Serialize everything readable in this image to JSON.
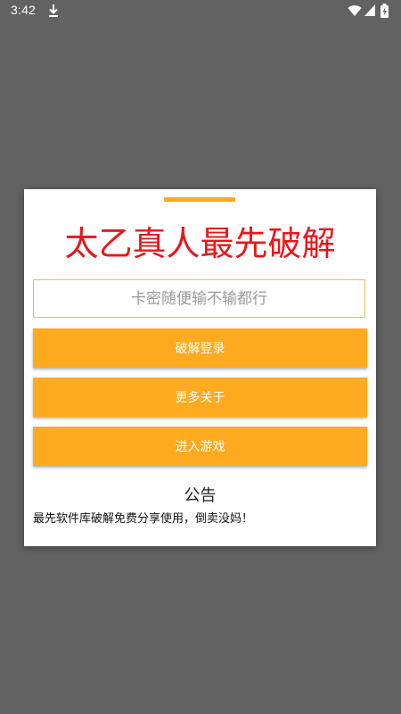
{
  "status_bar": {
    "time": "3:42",
    "icons": [
      "download-icon",
      "wifi-icon",
      "signal-icon",
      "battery-icon"
    ]
  },
  "dialog": {
    "title": "太乙真人最先破解",
    "key_input": {
      "placeholder": "卡密随便输不输都行",
      "value": ""
    },
    "buttons": {
      "login": "破解登录",
      "more": "更多关于",
      "enter": "进入游戏"
    },
    "notice": {
      "title": "公告",
      "text": "最先软件库破解免费分享使用，倒卖没妈！"
    }
  },
  "colors": {
    "accent": "#ffaa1f",
    "title": "#e8171b",
    "overlay": "#626262"
  }
}
